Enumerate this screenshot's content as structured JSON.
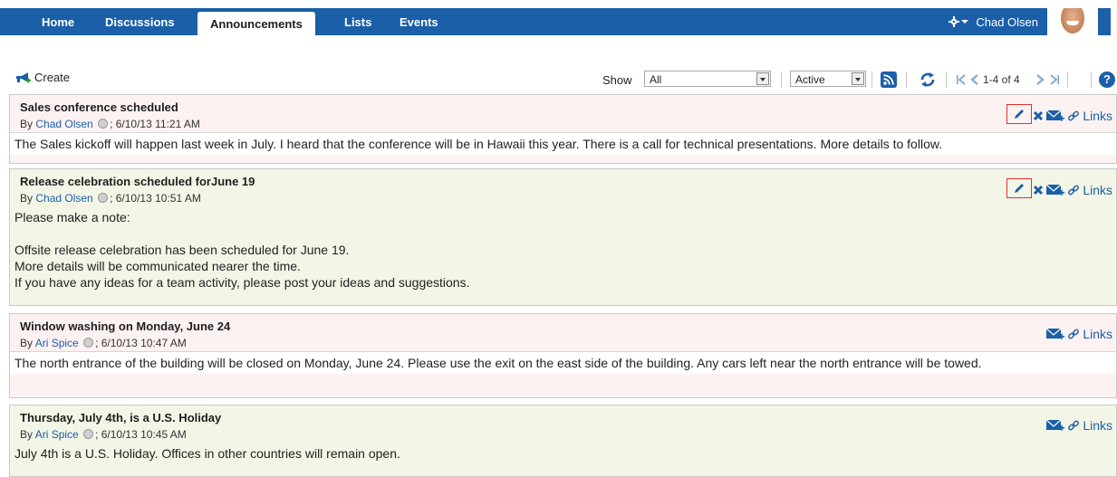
{
  "nav": {
    "tabs": [
      {
        "label": "Home"
      },
      {
        "label": "Discussions"
      },
      {
        "label": "Announcements",
        "active": true
      },
      {
        "label": "Lists"
      },
      {
        "label": "Events"
      }
    ],
    "user_name": "Chad Olsen"
  },
  "toolbar": {
    "create_label": "Create",
    "show_label": "Show",
    "show_value": "All",
    "status_value": "Active",
    "pager_text": "1-4 of 4",
    "help_label": "?"
  },
  "announcements": [
    {
      "title": "Sales conference scheduled",
      "by": "By",
      "author": "Chad Olsen",
      "date": "; 6/10/13 11:21 AM",
      "body": [
        "The Sales kickoff will happen last week in July. I heard that the conference will be in Hawaii this year. There is a call for technical presentations. More details to follow."
      ],
      "links_label": "Links"
    },
    {
      "title": "Release celebration scheduled forJune 19",
      "by": "By",
      "author": "Chad Olsen",
      "date": "; 6/10/13 10:51 AM",
      "body": [
        "Please make a note:",
        "",
        "Offsite release celebration has been scheduled for June 19.",
        "More details will be communicated nearer the time.",
        "If you have any ideas for a team activity, please post your ideas and suggestions."
      ],
      "links_label": "Links"
    },
    {
      "title": "Window washing on Monday, June 24",
      "by": "By",
      "author": "Ari Spice",
      "date": "; 6/10/13 10:47 AM",
      "body": [
        "The north entrance of the building will be closed on Monday, June 24. Please use the exit on the east side of the building. Any cars left near the north entrance will be towed."
      ],
      "links_label": "Links"
    },
    {
      "title": "Thursday, July 4th, is a U.S. Holiday",
      "by": "By",
      "author": "Ari Spice",
      "date": "; 6/10/13 10:45 AM",
      "body": [
        "July 4th is a U.S. Holiday. Offices in other countries will remain open."
      ],
      "links_label": "Links"
    }
  ],
  "colors": {
    "nav_bg": "#1a5fa8",
    "link": "#1a5fa8",
    "highlight_border": "#e03030"
  },
  "icons": [
    "gear-icon",
    "create-announcement-icon",
    "rss-icon",
    "refresh-icon",
    "first-page-icon",
    "prev-page-icon",
    "next-page-icon",
    "last-page-icon",
    "help-icon",
    "presence-icon",
    "edit-icon",
    "delete-icon",
    "mail-icon",
    "link-icon"
  ]
}
